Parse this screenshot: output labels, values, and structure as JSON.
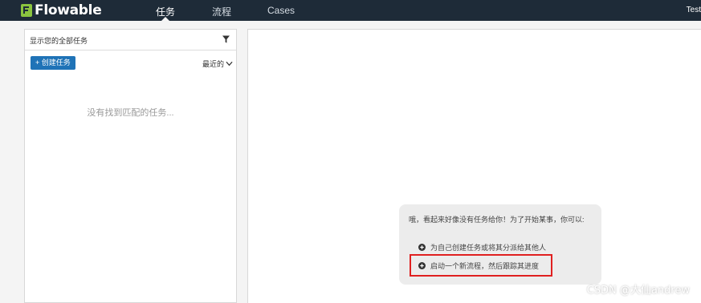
{
  "nav": {
    "brand": "Flowable",
    "items": [
      {
        "label": "任务",
        "active": true
      },
      {
        "label": "流程",
        "active": false
      },
      {
        "label": "Cases",
        "active": false
      }
    ],
    "user": "Test"
  },
  "task_list": {
    "filter_text": "显示您的全部任务",
    "create_button": "+ 创建任务",
    "sort_label": "最近的",
    "empty_message": "没有找到匹配的任务..."
  },
  "help": {
    "title": "哦，看起来好像没有任务给你！为了开始某事，你可以:",
    "options": [
      "为自己创建任务或将其分派给其他人",
      "启动一个新流程，然后跟踪其进度"
    ]
  },
  "watermark": "CSDN @大仙andrew",
  "colors": {
    "nav_bg": "#1e2b38",
    "brand_green": "#8bc53f",
    "button_blue": "#1f73b7",
    "highlight_red": "#e02020"
  }
}
